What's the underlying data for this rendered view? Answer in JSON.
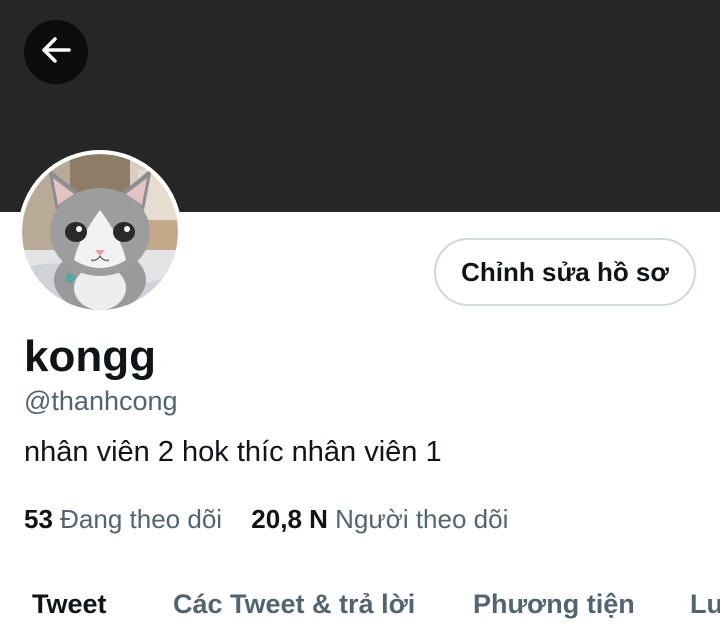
{
  "header": {
    "back_icon": "arrow-left-icon"
  },
  "profile": {
    "edit_button_label": "Chỉnh sửa hồ sơ",
    "display_name": "kongg",
    "handle": "@thanhcong",
    "bio": "nhân viên 2 hok thíc nhân viên 1",
    "following_count": "53",
    "following_label": "Đang theo dõi",
    "followers_count": "20,8 N",
    "followers_label": "Người theo dõi"
  },
  "tabs": [
    {
      "label": "Tweet",
      "active": true
    },
    {
      "label": "Các Tweet & trả lời",
      "active": false
    },
    {
      "label": "Phương tiện",
      "active": false
    },
    {
      "label": "Lư",
      "active": false
    }
  ],
  "colors": {
    "banner": "#262626",
    "text_primary": "#0f1419",
    "text_secondary": "#536471",
    "button_border": "#cfd9de"
  }
}
